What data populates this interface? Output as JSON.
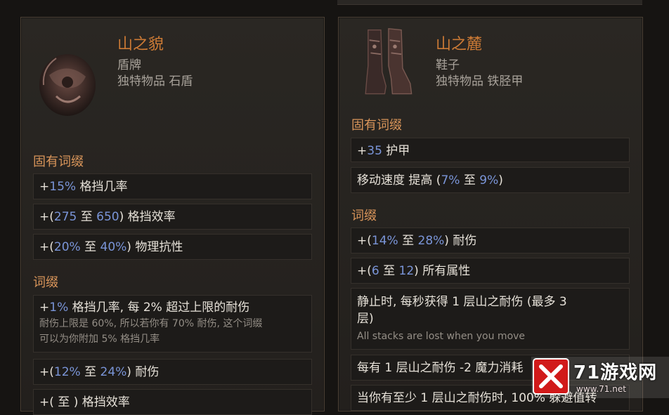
{
  "left_item": {
    "name": "山之貌",
    "type_line": "盾牌",
    "sub_line": "独特物品 石盾",
    "inherent_title": "固有词缀",
    "inherent": [
      {
        "prefix": "+",
        "value": "15%",
        "text": " 格挡几率"
      },
      {
        "prefix": "+(",
        "min": "275",
        "to": " 至 ",
        "max": "650",
        "suffix": ")",
        "text": " 格挡效率"
      },
      {
        "prefix": "+(",
        "min": "20%",
        "to": " 至 ",
        "max": "40%",
        "suffix": ")",
        "text": " 物理抗性"
      }
    ],
    "affix_title": "词缀",
    "affixes": [
      {
        "prefix": "+",
        "value": "1%",
        "text": " 格挡几率, 每 2% 超过上限的耐伤",
        "note1": "耐伤上限是 60%, 所以若你有 70% 耐伤, 这个词缀",
        "note2": "可以为你附加 5% 格挡几率"
      },
      {
        "prefix": "+(",
        "min": "12%",
        "to": " 至 ",
        "max": "24%",
        "suffix": ")",
        "text": " 耐伤"
      },
      {
        "prefix": "+(",
        "min": "",
        "to": " 至 ",
        "max": "",
        "suffix": ")",
        "text": " 格挡效率"
      }
    ]
  },
  "right_item": {
    "name": "山之麓",
    "type_line": "鞋子",
    "sub_line": "独特物品 铁胫甲",
    "inherent_title": "固有词缀",
    "inherent": [
      {
        "prefix": "+",
        "value": "35",
        "text": " 护甲"
      },
      {
        "text_before": "移动速度 提高 (",
        "min": "7%",
        "to": " 至 ",
        "max": "9%",
        "suffix": ")"
      }
    ],
    "affix_title": "词缀",
    "affixes": [
      {
        "prefix": "+(",
        "min": "14%",
        "to": " 至 ",
        "max": "28%",
        "suffix": ")",
        "text": " 耐伤"
      },
      {
        "prefix": "+(",
        "min": "6",
        "to": " 至 ",
        "max": "12",
        "suffix": ")",
        "text": " 所有属性"
      },
      {
        "line1": "静止时, 每秒获得 1 层山之耐伤 (最多 3",
        "line2": "层)",
        "note": "All stacks are lost when you move"
      },
      {
        "text": "每有 1 层山之耐伤 -2 魔力消耗"
      },
      {
        "text": "当你有至少 1 层山之耐伤时, 100% 躲避值转"
      }
    ]
  },
  "watermark": {
    "text": "71游戏网",
    "url_text": "www.71.net"
  },
  "colors": {
    "unique": "#cc7a35",
    "section": "#d9955a",
    "value": "#7a95d8",
    "panel": "#1d1b19"
  }
}
